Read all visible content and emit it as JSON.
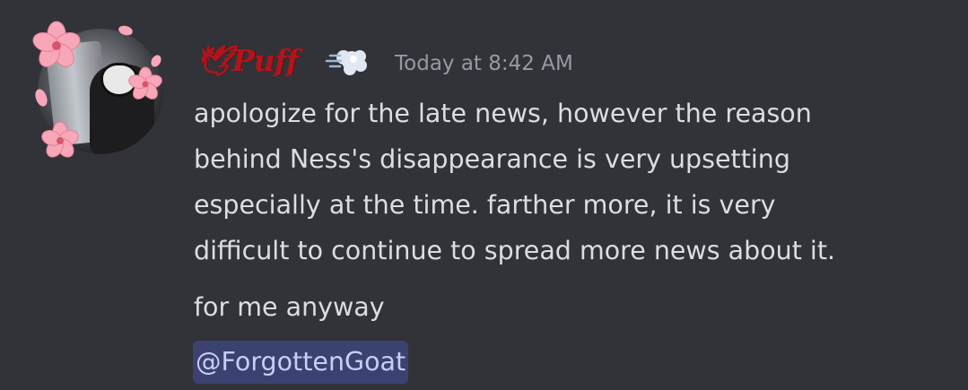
{
  "message": {
    "author": {
      "name": "🕊Puff",
      "role_icon": "puff-cloud-icon",
      "name_color": "#b3141c"
    },
    "timestamp": "Today at 8:42 AM",
    "body_lines": [
      "apologize for the late news, however the reason",
      "behind Ness's disappearance is very upsetting",
      "especially at the time. farther more, it is very",
      "difficult to continue to spread more news about it."
    ],
    "followup": "for me anyway",
    "mention": "@ForgottenGoat"
  },
  "colors": {
    "background": "#313338",
    "text": "#dbdee1",
    "timestamp": "#949ba4",
    "mention_bg": "#3c4270",
    "mention_text": "#c9cdfb"
  }
}
